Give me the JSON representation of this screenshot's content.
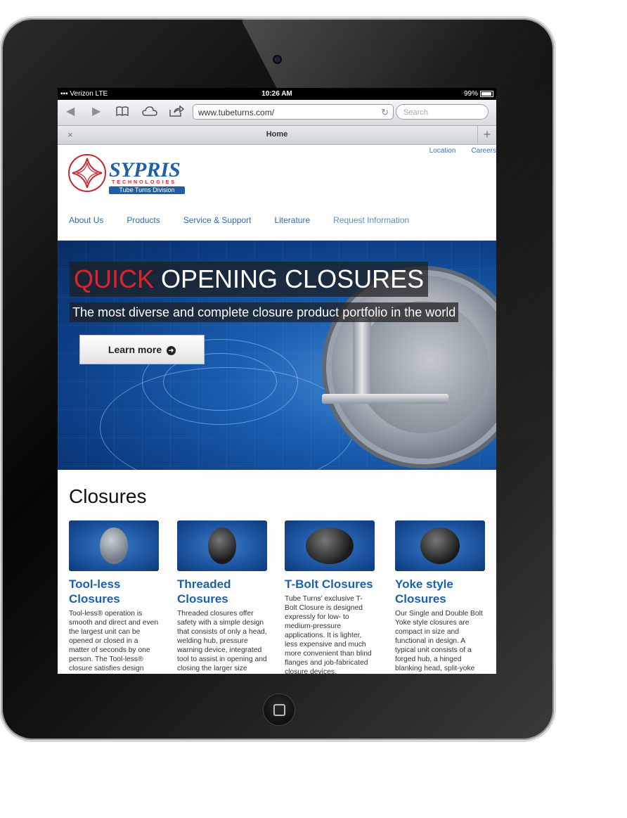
{
  "status": {
    "carrier": "Verizon  LTE",
    "time": "10:26 AM",
    "battery": "99%"
  },
  "browser": {
    "url": "www.tubeturns.com/",
    "search_placeholder": "Search",
    "tab_title": "Home",
    "tab_close": "×",
    "tab_add": "+"
  },
  "site": {
    "top_links": [
      "Location",
      "Careers"
    ],
    "logo": {
      "name": "SYPRIS",
      "tagline": "TECHNOLOGIES",
      "division": "Tube Turns Division"
    },
    "nav": [
      "About Us",
      "Products",
      "Service & Support",
      "Literature",
      "Request Information"
    ],
    "hero": {
      "title_highlight": "QUICK",
      "title_rest": " OPENING CLOSURES",
      "subtitle": "The most diverse and complete closure product portfolio in the world",
      "button": "Learn more"
    },
    "closures": {
      "heading": "Closures",
      "items": [
        {
          "title": "Tool-less Closures",
          "text": "Tool-less® operation is smooth and direct and even the largest unit can be opened or closed in a matter of seconds by one person. The Tool-less® closure satisfies design requirements in ASME"
        },
        {
          "title": "Threaded Closures",
          "text": "Threaded closures offer safety with a simple design that consists of only a head, welding hub, pressure warning device, integrated tool to assist in opening and closing the larger size closures and"
        },
        {
          "title": "T-Bolt Closures",
          "text": "Tube Turns' exclusive T-Bolt Closure is designed expressly for low- to medium-pressure applications. It is lighter, less expensive and much more convenient than blind flanges and job-fabricated closure devices."
        },
        {
          "title": "Yoke style Closures",
          "text": "Our Single and Double Bolt Yoke style closures are compact in size and functional in design. A typical unit consists of a forged hub, a hinged blanking head, split-yoke clamps, operating bolts,"
        }
      ]
    }
  },
  "colors": {
    "brand_blue": "#1f5fa8",
    "brand_red": "#c8262f",
    "link_blue": "#2a6bb5"
  }
}
